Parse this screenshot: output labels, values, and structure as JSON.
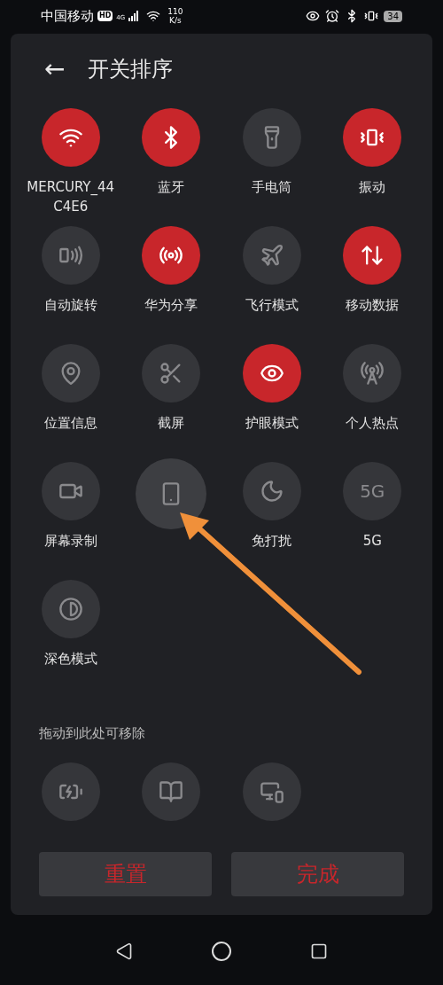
{
  "status_bar": {
    "carrier": "中国移动",
    "hd": "HD",
    "network": "4G",
    "speed_value": "110",
    "speed_unit": "K/s",
    "battery": "34"
  },
  "header": {
    "back": "←",
    "title": "开关排序"
  },
  "tiles": [
    {
      "kind": "toggle",
      "label": "MERCURY_44\nC4E6",
      "on": true
    },
    {
      "kind": "toggle",
      "label": "蓝牙",
      "on": true
    },
    {
      "kind": "toggle",
      "label": "手电筒",
      "on": false
    },
    {
      "kind": "toggle",
      "label": "振动",
      "on": true
    },
    {
      "kind": "toggle",
      "label": "自动旋转",
      "on": false
    },
    {
      "kind": "toggle",
      "label": "华为分享",
      "on": true
    },
    {
      "kind": "toggle",
      "label": "飞行模式",
      "on": false
    },
    {
      "kind": "toggle",
      "label": "移动数据",
      "on": true
    },
    {
      "kind": "toggle",
      "label": "位置信息",
      "on": false
    },
    {
      "kind": "toggle",
      "label": "截屏",
      "on": false
    },
    {
      "kind": "toggle",
      "label": "护眼模式",
      "on": true
    },
    {
      "kind": "toggle",
      "label": "个人热点",
      "on": false
    },
    {
      "kind": "toggle",
      "label": "屏幕录制",
      "on": false
    },
    {
      "kind": "dragging",
      "on": false
    },
    {
      "kind": "toggle",
      "label": "免打扰",
      "on": false
    },
    {
      "kind": "text_icon",
      "icon_text": "5G",
      "label": "5G",
      "on": false
    },
    {
      "kind": "toggle",
      "label": "深色模式",
      "on": false
    }
  ],
  "removable": {
    "title": "拖动到此处可移除",
    "tiles": [
      {
        "on": false
      },
      {
        "on": false
      },
      {
        "on": false
      }
    ]
  },
  "buttons": [
    "重置",
    "完成"
  ]
}
